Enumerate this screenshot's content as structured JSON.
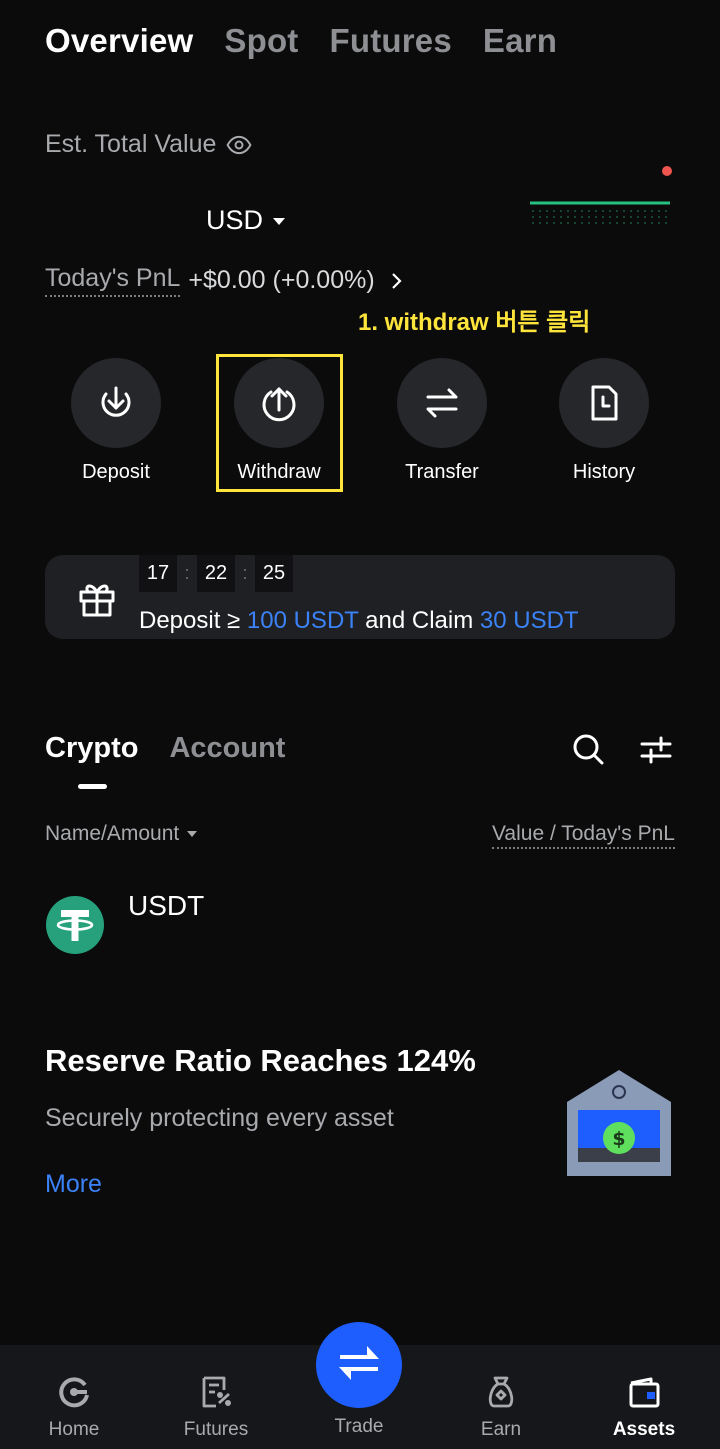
{
  "top_tabs": [
    "Overview",
    "Spot",
    "Futures",
    "Earn"
  ],
  "overview": {
    "est_total_label": "Est. Total Value",
    "currency": "USD",
    "pnl_label": "Today's PnL",
    "pnl_value": "+$0.00 (+0.00%)"
  },
  "annotation": "1. withdraw 버튼 클릭",
  "actions": [
    {
      "label": "Deposit",
      "icon": "deposit-icon"
    },
    {
      "label": "Withdraw",
      "icon": "withdraw-icon"
    },
    {
      "label": "Transfer",
      "icon": "transfer-icon"
    },
    {
      "label": "History",
      "icon": "history-icon"
    }
  ],
  "promo": {
    "timer_hours": "17",
    "timer_minutes": "22",
    "timer_seconds": "25",
    "text_prefix": "Deposit ≥ ",
    "text_amount": "100 USDT",
    "text_mid": " and Claim ",
    "text_reward": "30 USDT"
  },
  "asset_tabs": [
    "Crypto",
    "Account"
  ],
  "columns": {
    "left": "Name/Amount",
    "right": "Value / Today's PnL"
  },
  "assets": [
    {
      "name": "USDT"
    }
  ],
  "reserve": {
    "title": "Reserve Ratio Reaches 124%",
    "subtitle": "Securely protecting every asset",
    "more_label": "More"
  },
  "bottom_nav": [
    {
      "label": "Home"
    },
    {
      "label": "Futures"
    },
    {
      "label": "Trade"
    },
    {
      "label": "Earn"
    },
    {
      "label": "Assets"
    }
  ],
  "colors": {
    "background": "#0b0b0c",
    "accent_blue": "#3b82f6",
    "trade_button": "#1e5eff",
    "annotation_yellow": "#ffe53b",
    "usdt_green": "#26a17b",
    "alert_red": "#f0544f"
  }
}
